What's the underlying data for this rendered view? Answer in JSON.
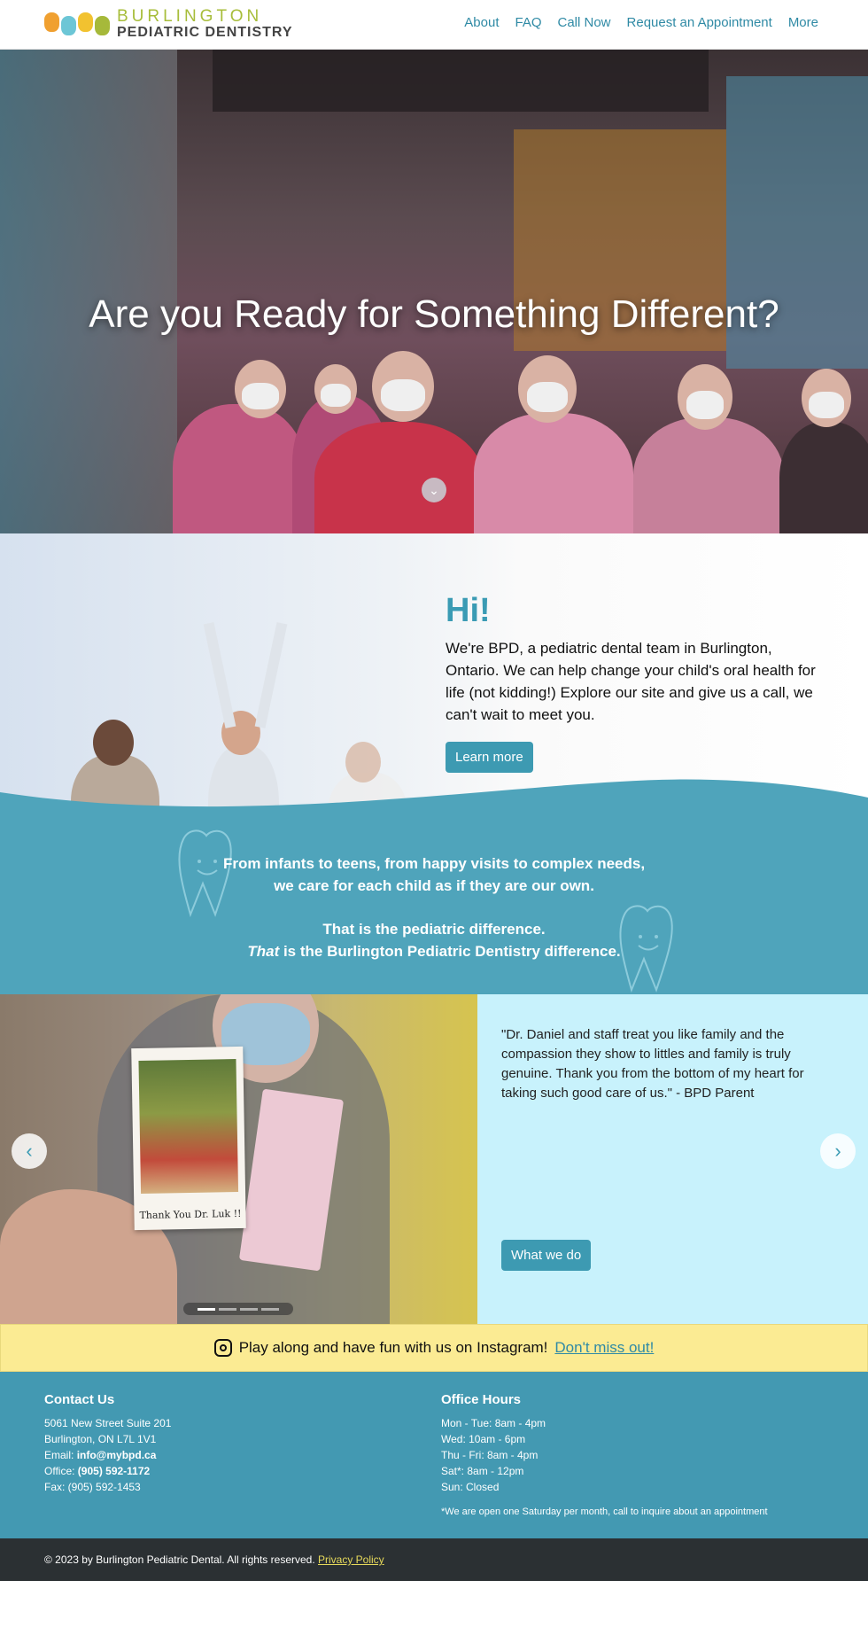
{
  "header": {
    "logo_line1": "BURLINGTON",
    "logo_line2": "PEDIATRIC DENTISTRY",
    "nav": [
      "About",
      "FAQ",
      "Call Now",
      "Request an Appointment",
      "More"
    ]
  },
  "hero": {
    "title": "Are you Ready for Something Different?",
    "scroll_icon": "chevron-down-icon"
  },
  "intro": {
    "heading": "Hi!",
    "body": "We're BPD, a pediatric dental team in Burlington, Ontario. We can help change your child's oral health for life (not kidding!) Explore our site and give us a call, we can't wait to meet you.",
    "button": "Learn more"
  },
  "band": {
    "line1": "From infants to teens, from happy visits to complex needs,",
    "line2": "we care for each child as if they are our own.",
    "line3": "That is the pediatric difference.",
    "line4_em": "That",
    "line4_rest": " is the Burlington Pediatric Dentistry difference."
  },
  "testimonial": {
    "quote": "\"Dr. Daniel and staff treat you like family and the compassion they show to littles and family is truly genuine. Thank you from the bottom of my heart for taking such good care of us.\" - BPD Parent",
    "button": "What we do",
    "polaroid_caption": "Thank You Dr. Luk !!",
    "slide_count": 4,
    "active_slide": 1
  },
  "instagram": {
    "text": "Play along and have fun with us on Instagram!",
    "link": "Don't miss out!"
  },
  "footer": {
    "contact_title": "Contact Us",
    "address1": "5061 New Street Suite 201",
    "address2": "Burlington, ON L7L 1V1",
    "email_label": "Email: ",
    "email": "info@mybpd.ca",
    "office_label": "Office: ",
    "office": "(905) 592-1172",
    "fax": "Fax: (905) 592-1453",
    "hours_title": "Office Hours",
    "hours": [
      "Mon - Tue: 8am - 4pm",
      "Wed: 10am - 6pm",
      "Thu - Fri: 8am - 4pm",
      "Sat*: 8am - 12pm",
      "Sun: Closed"
    ],
    "hours_note": "*We are open one Saturday per month, call to inquire about an appointment"
  },
  "bottom": {
    "copyright": "© 2023 by Burlington Pediatric Dental. All rights reserved. ",
    "privacy": "Privacy Policy"
  },
  "colors": {
    "accent": "#3d9ab2",
    "band": "#4fa4bb",
    "testimonial_bg": "#c8f2fc",
    "insta_bg": "#fbeb93",
    "footer": "#4399b2",
    "bottom": "#2b3033"
  }
}
